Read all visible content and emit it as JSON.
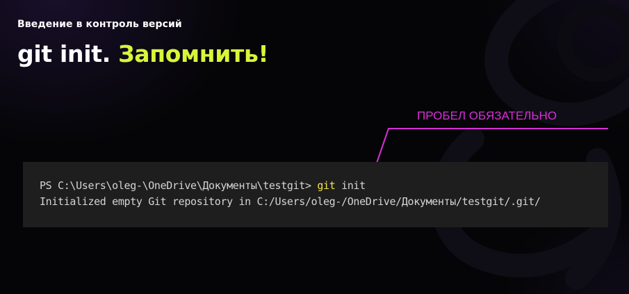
{
  "slide": {
    "subtitle": "Введение в контроль версий",
    "title_main": "git init.",
    "title_accent": "Запомнить!"
  },
  "terminal": {
    "line1_prompt": "PS C:\\Users\\oleg-\\OneDrive\\Документы\\testgit>",
    "line1_git": "git",
    "line1_rest": "init",
    "line2": "Initialized empty Git repository in C:/Users/oleg-/OneDrive/Документы/testgit/.git/"
  },
  "annotation": {
    "label": "ПРОБЕЛ ОБЯЗАТЕЛЬНО"
  },
  "colors": {
    "background": "#050507",
    "accent": "#d9f53a",
    "annotation": "#d82fd8",
    "terminal_bg": "#1e1e1e",
    "terminal_text": "#d4d4d4",
    "command_highlight": "#f0e64a"
  }
}
